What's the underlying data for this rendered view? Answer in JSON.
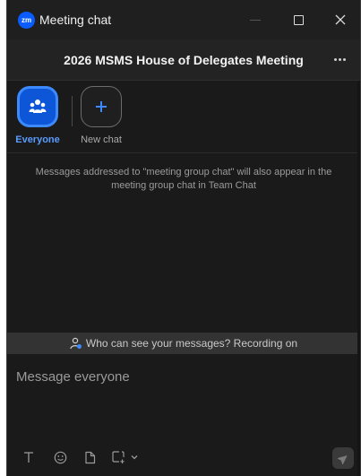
{
  "window": {
    "logo_text": "zm",
    "title": "Meeting chat"
  },
  "header": {
    "meeting_title": "2026 MSMS House of Delegates Meeting"
  },
  "recipients": [
    {
      "label": "Everyone",
      "selected": true,
      "icon": "people-icon"
    },
    {
      "label": "New chat",
      "selected": false,
      "icon": "plus-icon"
    }
  ],
  "messages": {
    "info": "Messages addressed to \"meeting group chat\" will also appear in the meeting group chat in Team Chat"
  },
  "visibility": {
    "text": "Who can see your messages? Recording on",
    "icon": "person-visibility-icon"
  },
  "composer": {
    "placeholder": "Message everyone",
    "tools": [
      "text-format-icon",
      "emoji-icon",
      "file-icon",
      "screenshot-icon",
      "chevron-down-icon"
    ],
    "send_icon": "send-icon"
  },
  "colors": {
    "accent": "#0e56d8",
    "accent_text": "#5a9bff",
    "background": "#1a1a1a"
  }
}
